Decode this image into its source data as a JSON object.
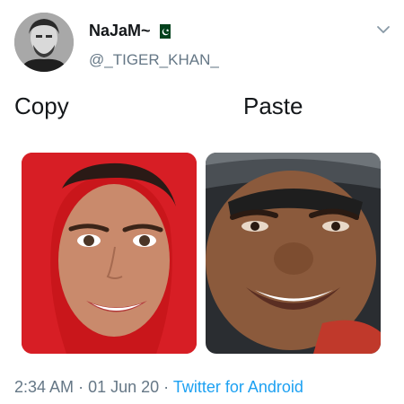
{
  "tweet": {
    "author": {
      "display_name": "NaJaM~",
      "flag_icon": "pakistan-flag-icon",
      "handle": "@_TIGER_KHAN_"
    },
    "menu_icon": "chevron-down-icon",
    "captions": {
      "left": "Copy",
      "right": "Paste"
    },
    "images": {
      "left": "photo-woman-red-headscarf-smiling",
      "right": "photo-man-helmet-smiling"
    },
    "meta": {
      "time": "2:34 AM",
      "separator": "·",
      "date": "01 Jun 20",
      "source": "Twitter for Android"
    },
    "colors": {
      "link": "#1da1f2",
      "secondary_text": "#657786",
      "flag_green": "#01411c"
    }
  }
}
